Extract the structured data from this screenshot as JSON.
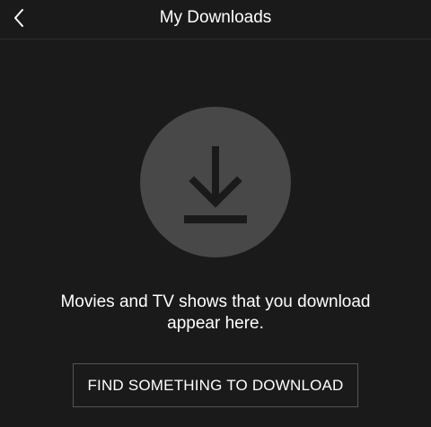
{
  "header": {
    "title": "My Downloads",
    "back_icon": "chevron-left-icon"
  },
  "empty_state": {
    "icon": "download-icon",
    "message_line1": "Movies and TV shows that you download",
    "message_line2": "appear here."
  },
  "actions": {
    "find_label": "FIND SOMETHING TO DOWNLOAD"
  },
  "colors": {
    "background": "#1a1a1a",
    "circle": "#484848",
    "icon": "#1a1a1a",
    "text": "#ffffff",
    "button_border": "#555555"
  }
}
